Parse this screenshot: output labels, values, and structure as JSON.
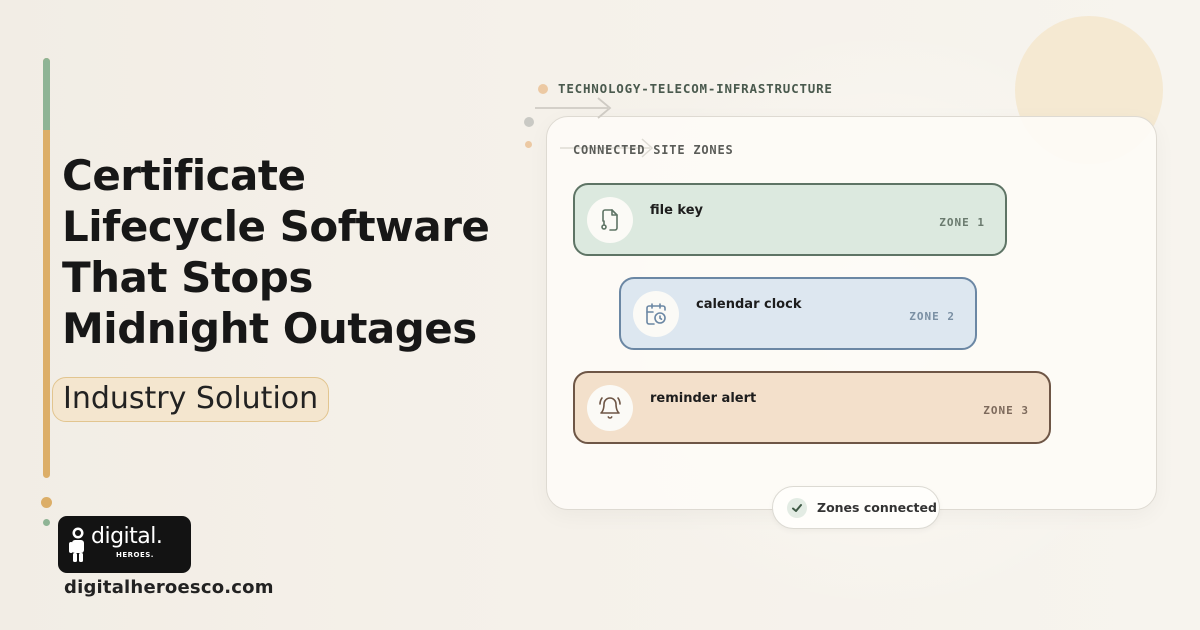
{
  "headline": {
    "lines": [
      "Certificate",
      "Lifecycle Software",
      "That Stops",
      "Midnight Outages"
    ]
  },
  "badge": "Industry Solution",
  "brand": {
    "logo_word": "digital.",
    "logo_sub": "HEROES.",
    "website": "digitalheroesco.com"
  },
  "industry_tag": "TECHNOLOGY-TELECOM-INFRASTRUCTURE",
  "card": {
    "title": "CONNECTED SITE ZONES",
    "zones": [
      {
        "name": "file key",
        "label": "ZONE 1",
        "icon": "file-key-icon",
        "color": "#5e7465"
      },
      {
        "name": "calendar clock",
        "label": "ZONE 2",
        "icon": "calendar-clock-icon",
        "color": "#6b87a4"
      },
      {
        "name": "reminder alert",
        "label": "ZONE 3",
        "icon": "bell-alert-icon",
        "color": "#6e5646"
      }
    ]
  },
  "status": "Zones connected",
  "colors": {
    "accent_gold": "#dcae68",
    "accent_green": "#8fb495",
    "zone1_bg": "#dce9df",
    "zone2_bg": "#dde7f0",
    "zone3_bg": "#f3e0cb"
  }
}
